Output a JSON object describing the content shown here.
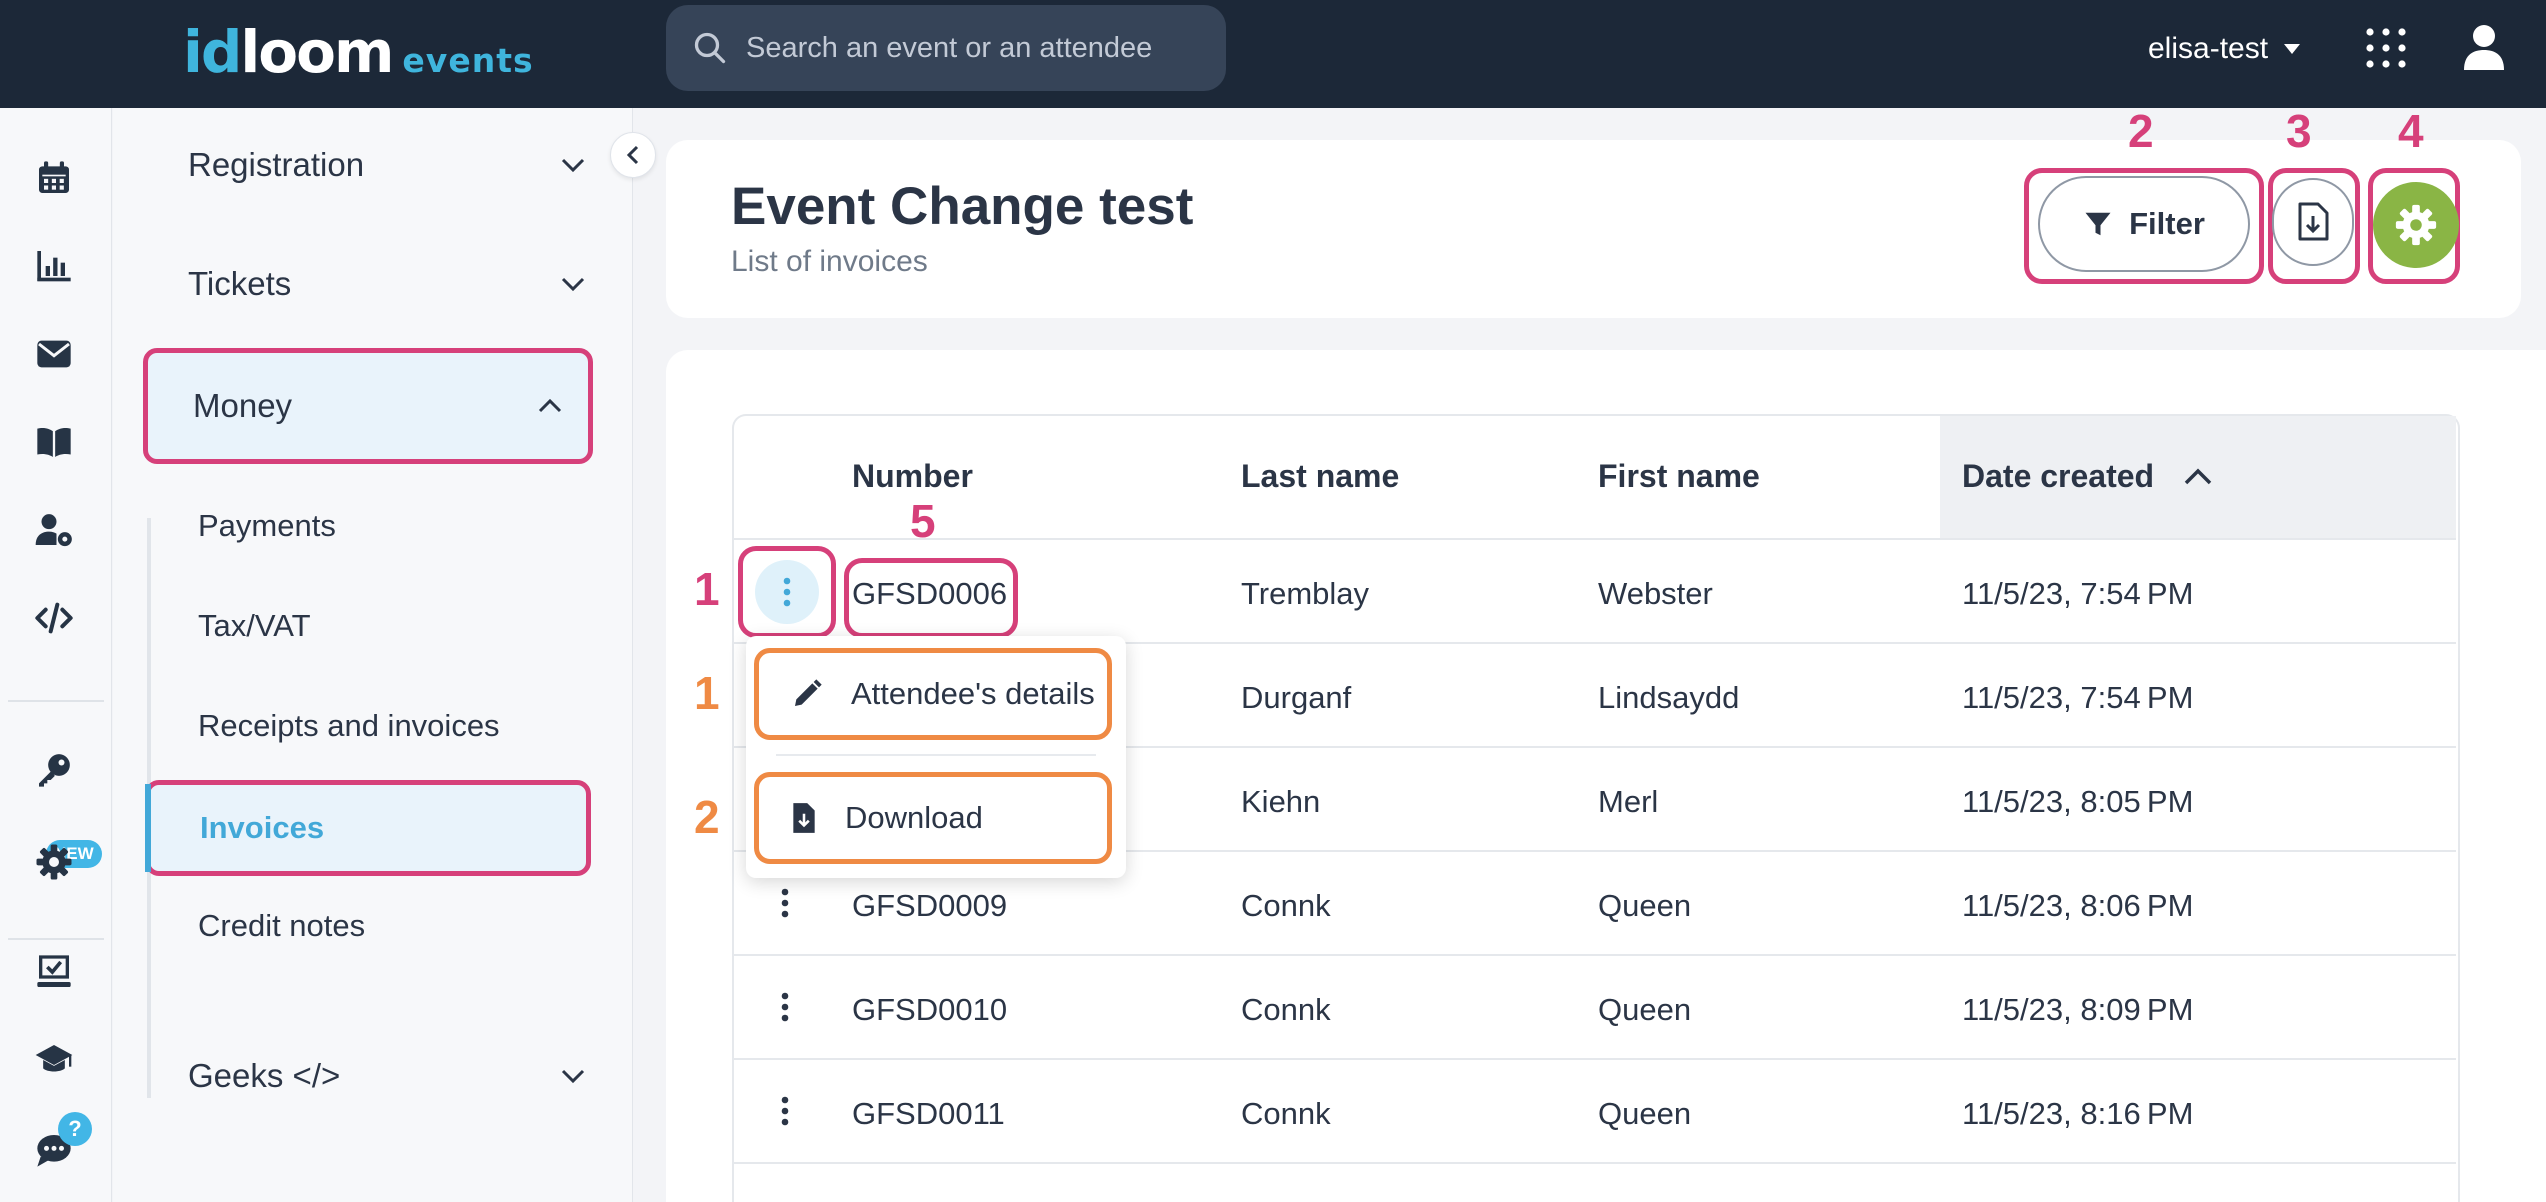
{
  "brand": {
    "logo_id": "id",
    "logo_loom": "loom",
    "logo_sub": "events"
  },
  "search": {
    "placeholder": "Search an event or an attendee"
  },
  "user": {
    "name": "elisa-test"
  },
  "rail": {
    "badge_new": "NEW",
    "badge_help": "?"
  },
  "menu": {
    "registration": "Registration",
    "tickets": "Tickets",
    "money": "Money",
    "money_items": [
      "Payments",
      "Tax/VAT",
      "Receipts and invoices",
      "Invoices",
      "Credit notes"
    ],
    "geeks": "Geeks </>"
  },
  "header": {
    "title": "Event Change test",
    "subtitle": "List of invoices",
    "filter_label": "Filter"
  },
  "annotations": {
    "n1": "1",
    "n2": "2",
    "n3": "3",
    "n4": "4",
    "n5": "5"
  },
  "table": {
    "columns": [
      "Number",
      "Last name",
      "First name",
      "Date created"
    ],
    "rows": [
      {
        "number": "GFSD0006",
        "last": "Tremblay",
        "first": "Webster",
        "date": "11/5/23, 7:54 PM"
      },
      {
        "number": "",
        "last": "Durganf",
        "first": "Lindsaydd",
        "date": "11/5/23, 7:54 PM"
      },
      {
        "number": "",
        "last": "Kiehn",
        "first": "Merl",
        "date": "11/5/23, 8:05 PM"
      },
      {
        "number": "GFSD0009",
        "last": "Connk",
        "first": "Queen",
        "date": "11/5/23, 8:06 PM"
      },
      {
        "number": "GFSD0010",
        "last": "Connk",
        "first": "Queen",
        "date": "11/5/23, 8:09 PM"
      },
      {
        "number": "GFSD0011",
        "last": "Connk",
        "first": "Queen",
        "date": "11/5/23, 8:16 PM"
      }
    ]
  },
  "dropdown": {
    "attendee_details": "Attendee's details",
    "download": "Download"
  },
  "colors": {
    "topbar": "#1c2838",
    "accent_blue": "#42a8d8",
    "highlight_pink": "#d6407a",
    "highlight_orange": "#ef8a44",
    "settings_green": "#8ab545"
  }
}
